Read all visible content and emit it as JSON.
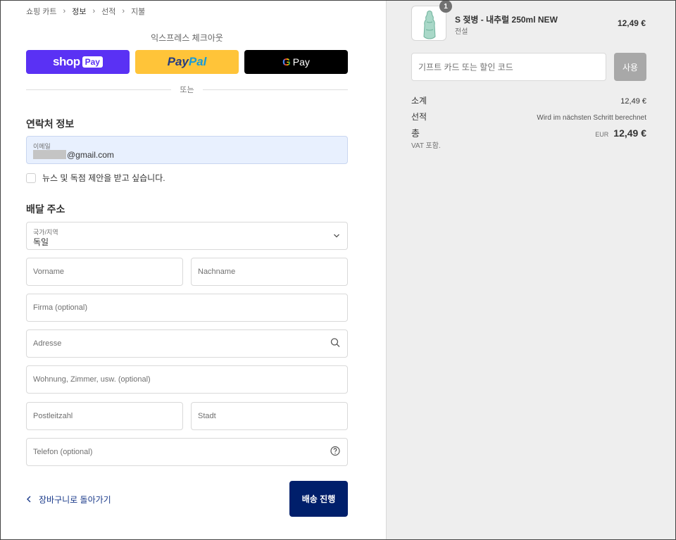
{
  "breadcrumb": {
    "cart": "쇼핑 카트",
    "info": "정보",
    "shipping": "선적",
    "payment": "지불"
  },
  "express": {
    "title": "익스프레스 체크아웃",
    "shop_brand": "shop",
    "shop_pay": "Pay",
    "paypal_a": "Pay",
    "paypal_b": "Pal",
    "gpay_g": "G",
    "gpay_text": "Pay",
    "or": "또는"
  },
  "contact": {
    "title": "연락처 정보",
    "email_label": "이메일",
    "email_value": "@gmail.com",
    "newsletter": "뉴스 및 독점 제안을 받고 싶습니다."
  },
  "delivery": {
    "title": "배달 주소",
    "country_label": "국가/지역",
    "country_value": "독일",
    "first_name": "Vorname",
    "last_name": "Nachname",
    "company": "Firma (optional)",
    "address": "Adresse",
    "apartment": "Wohnung, Zimmer, usw. (optional)",
    "postal": "Postleitzahl",
    "city": "Stadt",
    "phone": "Telefon (optional)"
  },
  "footer": {
    "back": "장바구니로 돌아가기",
    "submit": "배송 진행"
  },
  "order": {
    "qty_badge": "1",
    "product_name": "S 젖병 - 내추럴 250ml NEW",
    "product_variant": "전설",
    "product_price": "12,49 €",
    "gift_placeholder": "기프트 카드 또는 할인 코드",
    "apply": "사용",
    "subtotal_label": "소계",
    "subtotal_value": "12,49 €",
    "shipping_label": "선적",
    "shipping_value": "Wird im nächsten Schritt berechnet",
    "total_label": "총",
    "total_sub": "VAT 포함.",
    "currency": "EUR",
    "total_value": "12,49 €"
  },
  "icons": {
    "chevron": "chevron-down-icon",
    "search": "search-icon",
    "help": "question-circle-icon"
  }
}
